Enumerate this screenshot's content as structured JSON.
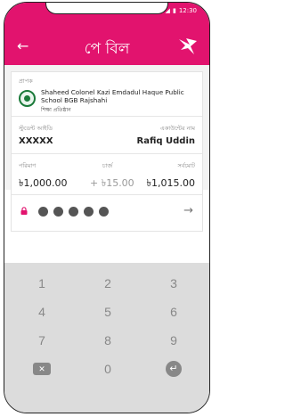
{
  "status_bar": {
    "time": "12:30",
    "signal": "▼◢",
    "battery": "▮"
  },
  "header": {
    "back_icon": "←",
    "title": "পে বিল"
  },
  "recipient": {
    "label": "প্রাপক",
    "name": "Shaheed Colonel Kazi Emdadul Haque Public School BGB Rajshahi",
    "subtitle": "শিক্ষা প্রতিষ্ঠান"
  },
  "ids": {
    "student_id_label": "স্টুডেন্ট আইডি",
    "student_id_value": "XXXXX",
    "account_name_label": "একাউন্টের নাম",
    "account_name_value": "Rafiq Uddin"
  },
  "amounts": {
    "amount_label": "পরিমাণ",
    "amount_value": "৳1,000.00",
    "charge_label": "চার্জ",
    "charge_value": "+ ৳15.00",
    "total_label": "সর্বমোট",
    "total_value": "৳1,015.00"
  },
  "pin": {
    "arrow": "→"
  },
  "keypad": {
    "keys": [
      "1",
      "2",
      "3",
      "4",
      "5",
      "6",
      "7",
      "8",
      "9",
      "0"
    ],
    "backspace": "✕",
    "enter": "↵"
  }
}
